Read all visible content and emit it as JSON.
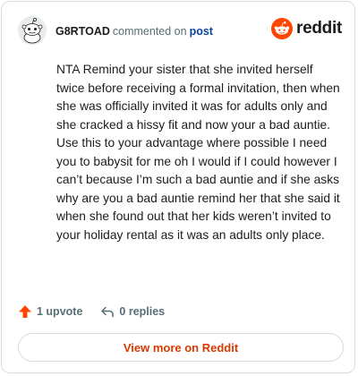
{
  "header": {
    "username": "G8RTOAD",
    "action_text": "commented on",
    "post_link": "post"
  },
  "brand": {
    "wordmark": "reddit",
    "color": "#ff4500"
  },
  "comment": {
    "body": "NTA Remind your sister that she invited herself twice before receiving a formal invitation, then when she was officially invited it was for adults only and she cracked a hissy fit and now your a bad auntie. Use this to your advantage where possible I need you to babysit for me oh I would if I could however I can’t because I’m such a bad auntie and if she asks why are you a bad auntie remind her that she said it when she found out that her kids weren’t invited to your holiday rental as it was an adults only place."
  },
  "actions": {
    "upvote_label": "1 upvote",
    "replies_label": "0 replies",
    "upvote_color": "#ff4500"
  },
  "footer": {
    "view_more_label": "View more on Reddit",
    "link_color": "#d93a00"
  },
  "icons": {
    "avatar": "snoo-avatar-icon",
    "brand": "reddit-logo-icon",
    "upvote": "upvote-arrow-icon",
    "reply": "reply-arrow-icon"
  }
}
